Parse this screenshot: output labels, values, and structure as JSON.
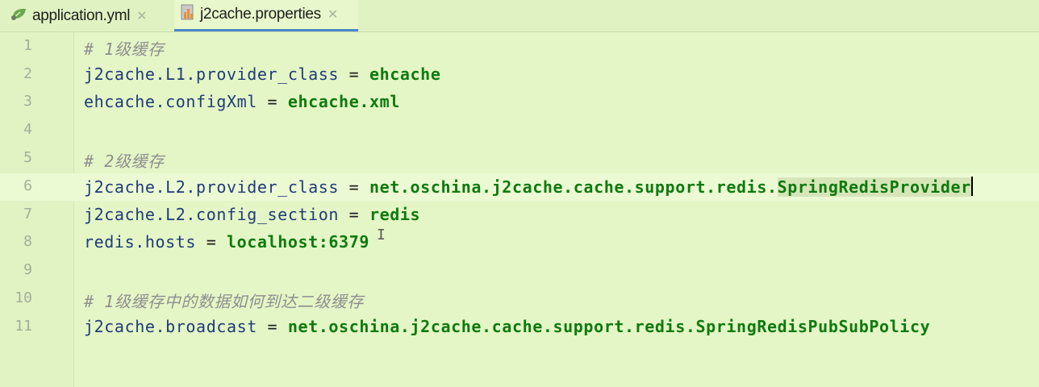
{
  "tabs": [
    {
      "label": "application.yml",
      "icon": "yaml-file-icon",
      "active": false
    },
    {
      "label": "j2cache.properties",
      "icon": "properties-file-icon",
      "active": true
    }
  ],
  "editor": {
    "lines": [
      {
        "n": "1",
        "comment": "# 1级缓存"
      },
      {
        "n": "2",
        "key": "j2cache.L1.provider_class",
        "sep": " = ",
        "value": "ehcache"
      },
      {
        "n": "3",
        "key": "ehcache.configXml",
        "sep": " = ",
        "value": "ehcache.xml"
      },
      {
        "n": "4"
      },
      {
        "n": "5",
        "comment": "# 2级缓存"
      },
      {
        "n": "6",
        "key": "j2cache.L2.provider_class",
        "sep": " = ",
        "value_a": "net.oschina.j2cache.cache.support.redis.",
        "value_b": "SpringRedisProvider"
      },
      {
        "n": "7",
        "key": "j2cache.L2.config_section",
        "sep": " = ",
        "value": "redis"
      },
      {
        "n": "8",
        "key": "redis.hosts",
        "sep": " = ",
        "value": "localhost:6379"
      },
      {
        "n": "9"
      },
      {
        "n": "10",
        "comment": "# 1级缓存中的数据如何到达二级缓存"
      },
      {
        "n": "11",
        "key": "j2cache.broadcast",
        "sep": " = ",
        "value": "net.oschina.j2cache.cache.support.redis.SpringRedisPubSubPolicy"
      }
    ]
  },
  "colors": {
    "background": "#e4f6c6",
    "comment": "#8f8f8f",
    "key": "#1f3b78",
    "value": "#0e7a0e",
    "tab_underline": "#4a86c8"
  }
}
